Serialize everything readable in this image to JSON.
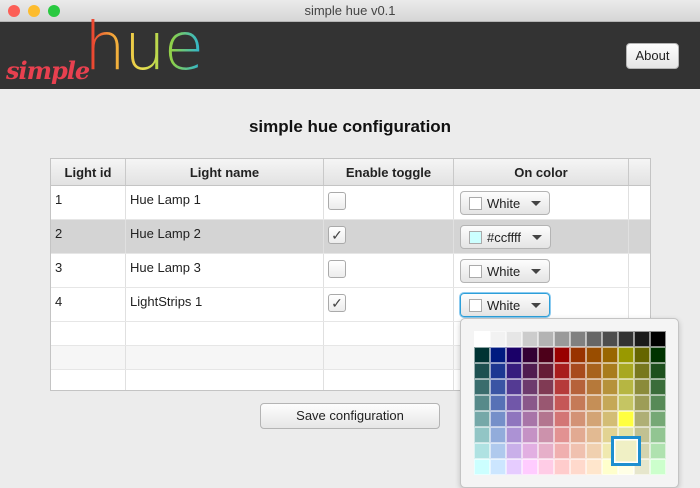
{
  "window": {
    "title": "simple hue v0.1"
  },
  "header": {
    "logo_simple": "simple",
    "logo_hue": "hue",
    "about_label": "About"
  },
  "page_title": "simple hue configuration",
  "table": {
    "columns": [
      "Light id",
      "Light name",
      "Enable toggle",
      "On color"
    ],
    "rows": [
      {
        "id": "1",
        "name": "Hue Lamp 1",
        "enabled": false,
        "color": "White",
        "swatch": "#ffffff"
      },
      {
        "id": "2",
        "name": "Hue Lamp 2",
        "enabled": true,
        "color": "#ccffff",
        "swatch": "#ccffff"
      },
      {
        "id": "3",
        "name": "Hue Lamp 3",
        "enabled": false,
        "color": "White",
        "swatch": "#ffffff"
      },
      {
        "id": "4",
        "name": "LightStrips 1",
        "enabled": true,
        "color": "White",
        "swatch": "#ffffff"
      }
    ]
  },
  "save_label": "Save configuration",
  "check_glyph": "✓"
}
